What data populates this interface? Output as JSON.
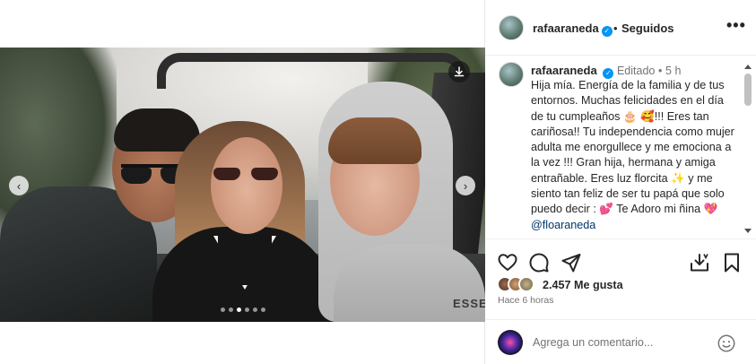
{
  "post": {
    "author": "rafaaraneda",
    "follow_status": "Seguidos",
    "more_icon": "•••",
    "separator": "•",
    "verified_glyph": "✓",
    "caption_edited": "Editado",
    "caption_time": "5 h",
    "caption_text": "Hija mía.  Energía de la  familia y de tus entornos. Muchas felicidades en el día de tu cumpleaños 🎂 🥰!!! Eres tan cariñosa!! Tu independencia como mujer adulta me enorgullece y me emociona a la vez !!! Gran hija, hermana y amiga entrañable. Eres luz florcita ✨ y me siento tan feliz de ser tu papá que solo puedo decir : 💕 Te Adoro mi ñina 💖",
    "mention": "@floaraneda",
    "likes": "2.457 Me gusta",
    "posted_ago": "Hace 6 horas",
    "photo_text": "ESSEN",
    "carousel": {
      "count": 6,
      "active_index": 2
    }
  },
  "comment": {
    "placeholder": "Agrega un comentario..."
  },
  "icons": {
    "nav_prev": "‹",
    "nav_next": "›",
    "download": "download-icon",
    "like": "heart-icon",
    "comment": "comment-icon",
    "share": "paper-plane-icon",
    "repost": "repost-icon",
    "save": "bookmark-icon",
    "emoji": "smiley-icon"
  },
  "colors": {
    "verified": "#0095f6",
    "mention": "#00376b",
    "meta": "#737373"
  }
}
